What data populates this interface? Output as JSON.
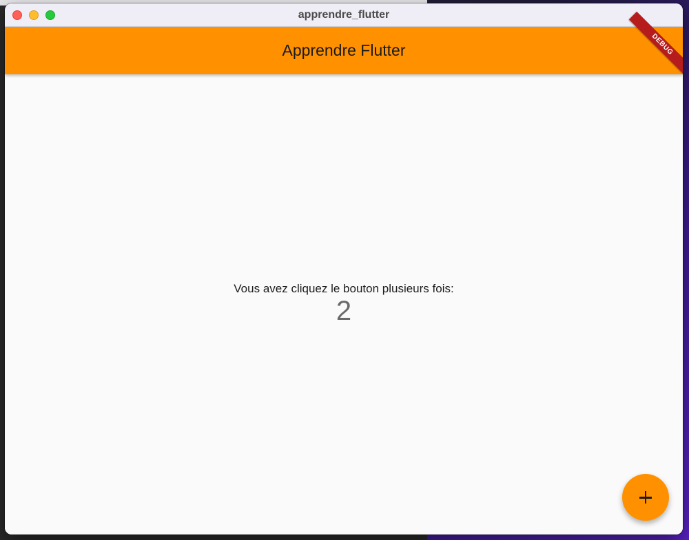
{
  "window": {
    "title": "apprendre_flutter"
  },
  "appbar": {
    "title": "Apprendre Flutter",
    "debug_label": "DEBUG",
    "color": "#ff9100"
  },
  "main": {
    "message": "Vous avez cliquez le bouton plusieurs fois:",
    "counter": "2"
  },
  "fab": {
    "icon": "plus-icon",
    "color": "#ff9100"
  }
}
